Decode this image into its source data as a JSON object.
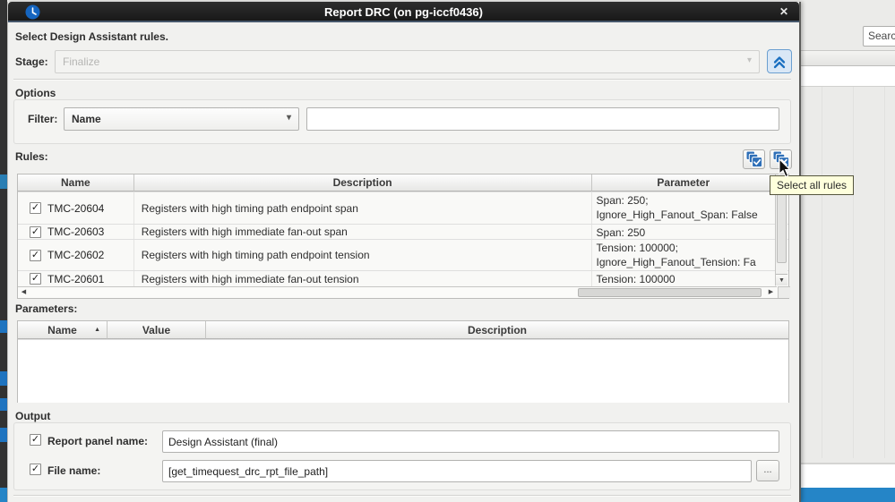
{
  "window": {
    "title": "Report DRC (on pg-iccf0436)",
    "close_glyph": "✕"
  },
  "intro_text": "Select Design Assistant rules.",
  "stage": {
    "label": "Stage:",
    "value": "Finalize"
  },
  "options": {
    "section_label": "Options",
    "filter_label": "Filter:",
    "filter_selected": "Name",
    "filter_query": ""
  },
  "rules": {
    "section_label": "Rules:",
    "columns": {
      "name": "Name",
      "description": "Description",
      "parameter": "Parameter"
    },
    "rows": [
      {
        "checked": true,
        "name": "TMC-20604",
        "description": "Registers with high timing path endpoint span",
        "param_lines": [
          "Span: 250;",
          "Ignore_High_Fanout_Span: False"
        ]
      },
      {
        "checked": true,
        "name": "TMC-20603",
        "description": "Registers with high immediate fan-out span",
        "param_lines": [
          "Span: 250"
        ]
      },
      {
        "checked": true,
        "name": "TMC-20602",
        "description": "Registers with high timing path endpoint tension",
        "param_lines": [
          "Tension: 100000;",
          "Ignore_High_Fanout_Tension: Fa"
        ]
      },
      {
        "checked": true,
        "name": "TMC-20601",
        "description": "Registers with high immediate fan-out tension",
        "param_lines": [
          "Tension: 100000"
        ]
      }
    ],
    "tooltip": "Select all rules"
  },
  "parameters": {
    "section_label": "Parameters:",
    "columns": {
      "name": "Name",
      "value": "Value",
      "description": "Description"
    }
  },
  "output": {
    "section_label": "Output",
    "report_panel": {
      "label": "Report panel name:",
      "value": "Design Assistant (final)"
    },
    "file_name": {
      "label": "File name:",
      "value": "[get_timequest_drc_rpt_file_path]",
      "browse_label": "..."
    }
  },
  "background": {
    "search_text": "Searc"
  },
  "glyphs": {
    "check": "✓",
    "dropdown_arrow": "▾",
    "sort_asc": "▲",
    "scroll_left": "◀",
    "scroll_right": "▶",
    "scroll_down": "▼"
  },
  "colors": {
    "titlebar": "#1e1e1e",
    "dialog_bg": "#f1f1ef",
    "accent_blue": "#2e6fb7",
    "collapse_btn_bg": "#d9e7f6",
    "tooltip_bg": "#feffdc",
    "bottom_bar_blue": "#2585c7"
  }
}
